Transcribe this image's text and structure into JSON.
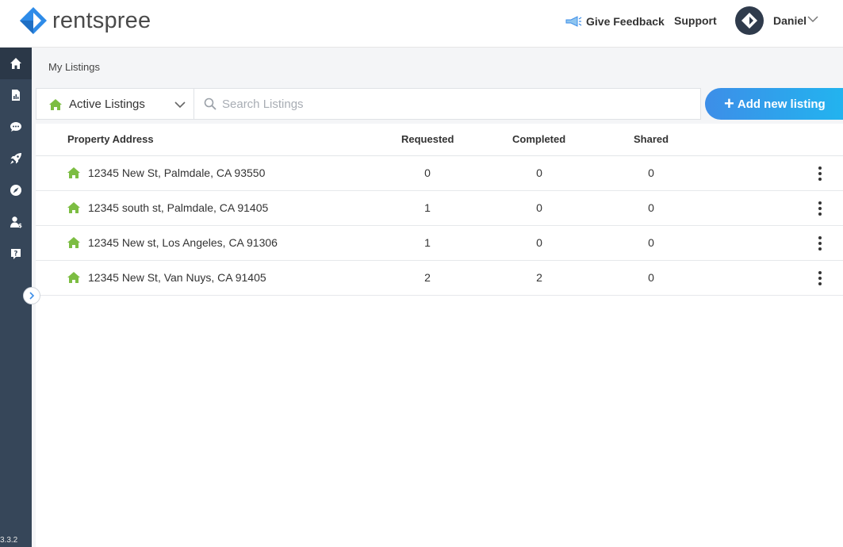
{
  "brand": {
    "logo_text": "rentspree",
    "colors": {
      "primary": "#3d8ee8",
      "sidebar": "#364659",
      "house_green": "#7cbd42"
    }
  },
  "header": {
    "feedback_label": "Give Feedback",
    "feedback_icon": "megaphone-icon",
    "support_label": "Support",
    "user_name": "Daniel"
  },
  "sidebar": {
    "items": [
      {
        "name": "home",
        "icon": "home-icon"
      },
      {
        "name": "reports",
        "icon": "report-icon"
      },
      {
        "name": "messages",
        "icon": "chat-icon"
      },
      {
        "name": "launch",
        "icon": "rocket-icon"
      },
      {
        "name": "explore",
        "icon": "compass-icon"
      },
      {
        "name": "agent",
        "icon": "user-dollar-icon"
      },
      {
        "name": "help",
        "icon": "help-icon"
      }
    ],
    "version": "3.3.2"
  },
  "breadcrumb": "My Listings",
  "filter": {
    "selected": "Active Listings",
    "search_placeholder": "Search Listings"
  },
  "add_button": {
    "label": "Add new listing"
  },
  "table": {
    "columns": [
      "Property Address",
      "Requested",
      "Completed",
      "Shared"
    ],
    "rows": [
      {
        "address": "12345 New St, Palmdale, CA 93550",
        "requested": "0",
        "completed": "0",
        "shared": "0"
      },
      {
        "address": "12345 south st, Palmdale, CA 91405",
        "requested": "1",
        "completed": "0",
        "shared": "0"
      },
      {
        "address": "12345 New st, Los Angeles, CA 91306",
        "requested": "1",
        "completed": "0",
        "shared": "0"
      },
      {
        "address": "12345 New St, Van Nuys, CA 91405",
        "requested": "2",
        "completed": "2",
        "shared": "0"
      }
    ]
  }
}
